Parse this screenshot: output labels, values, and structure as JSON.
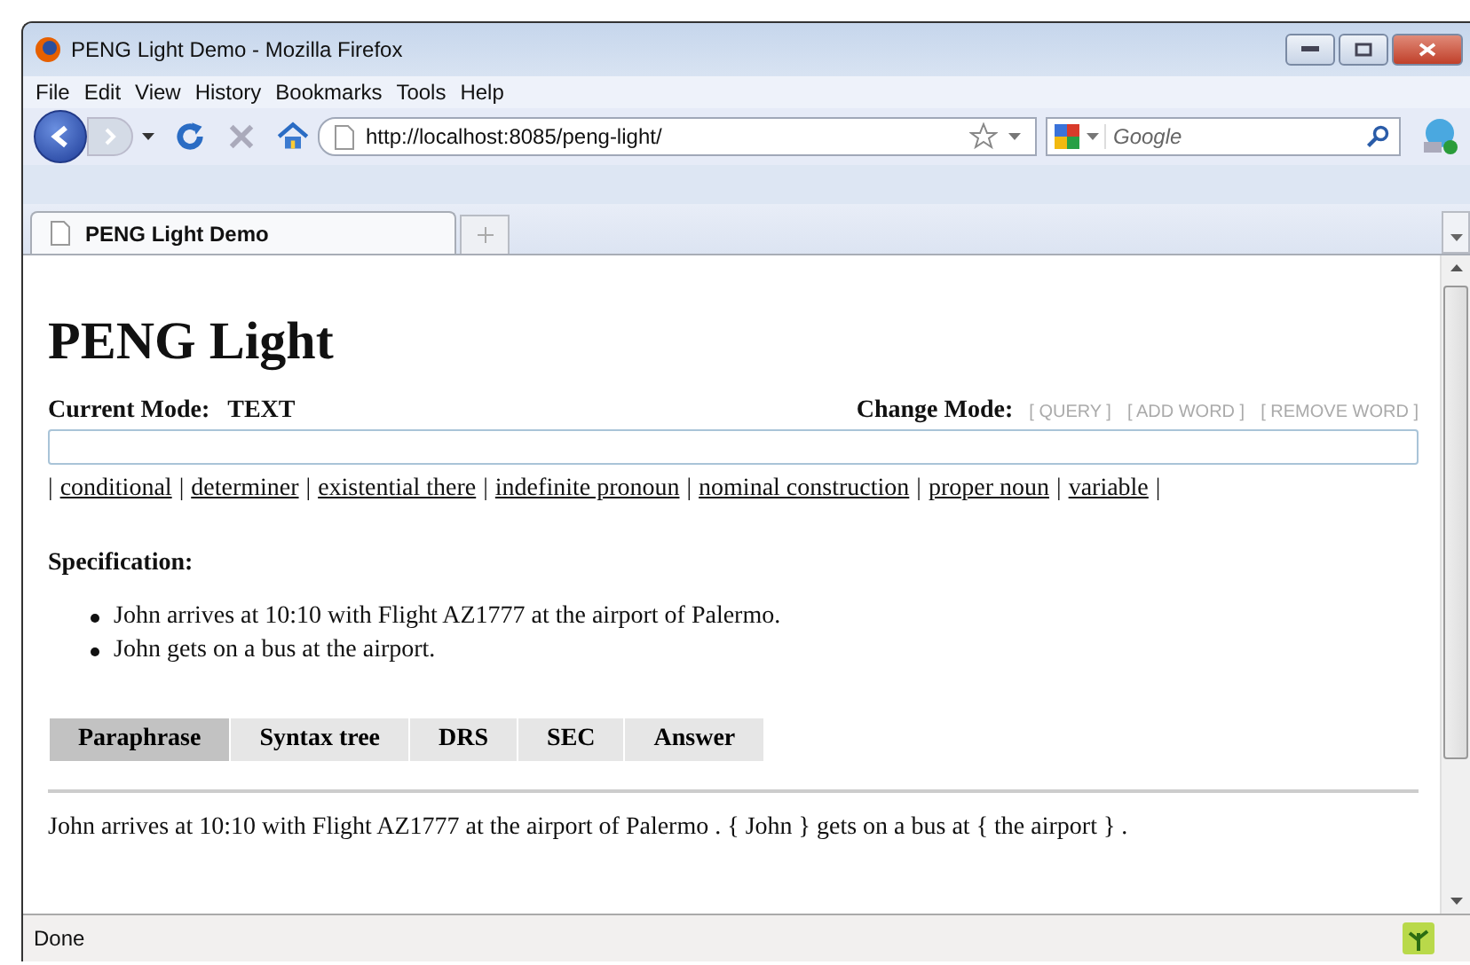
{
  "window": {
    "title": "PENG Light Demo - Mozilla Firefox"
  },
  "menu": [
    "File",
    "Edit",
    "View",
    "History",
    "Bookmarks",
    "Tools",
    "Help"
  ],
  "address_bar": {
    "value": "http://localhost:8085/peng-light/"
  },
  "search": {
    "placeholder": "Google"
  },
  "tabs": [
    {
      "label": "PENG Light Demo",
      "selected": true
    }
  ],
  "page": {
    "heading": "PENG Light",
    "current_mode": {
      "label": "Current Mode:",
      "value": "TEXT"
    },
    "change_mode": {
      "label": "Change Mode:",
      "options": [
        "[ QUERY ]",
        "[ ADD WORD ]",
        "[ REMOVE WORD ]"
      ]
    },
    "category_separator": "|",
    "categories": [
      "conditional",
      "determiner",
      "existential there",
      "indefinite pronoun",
      "nominal construction",
      "proper noun",
      "variable"
    ],
    "specification": {
      "label": "Specification:",
      "items": [
        "John arrives at 10:10 with Flight AZ1777 at the airport of Palermo.",
        "John gets on a bus at the airport."
      ]
    },
    "tabs": [
      {
        "label": "Paraphrase",
        "selected": true
      },
      {
        "label": "Syntax tree",
        "selected": false
      },
      {
        "label": "DRS",
        "selected": false
      },
      {
        "label": "SEC",
        "selected": false
      },
      {
        "label": "Answer",
        "selected": false
      }
    ],
    "output": "John arrives at 10:10 with Flight AZ1777 at the airport of Palermo . { John } gets on a bus at { the airport } ."
  },
  "status_bar": {
    "text": "Done"
  }
}
